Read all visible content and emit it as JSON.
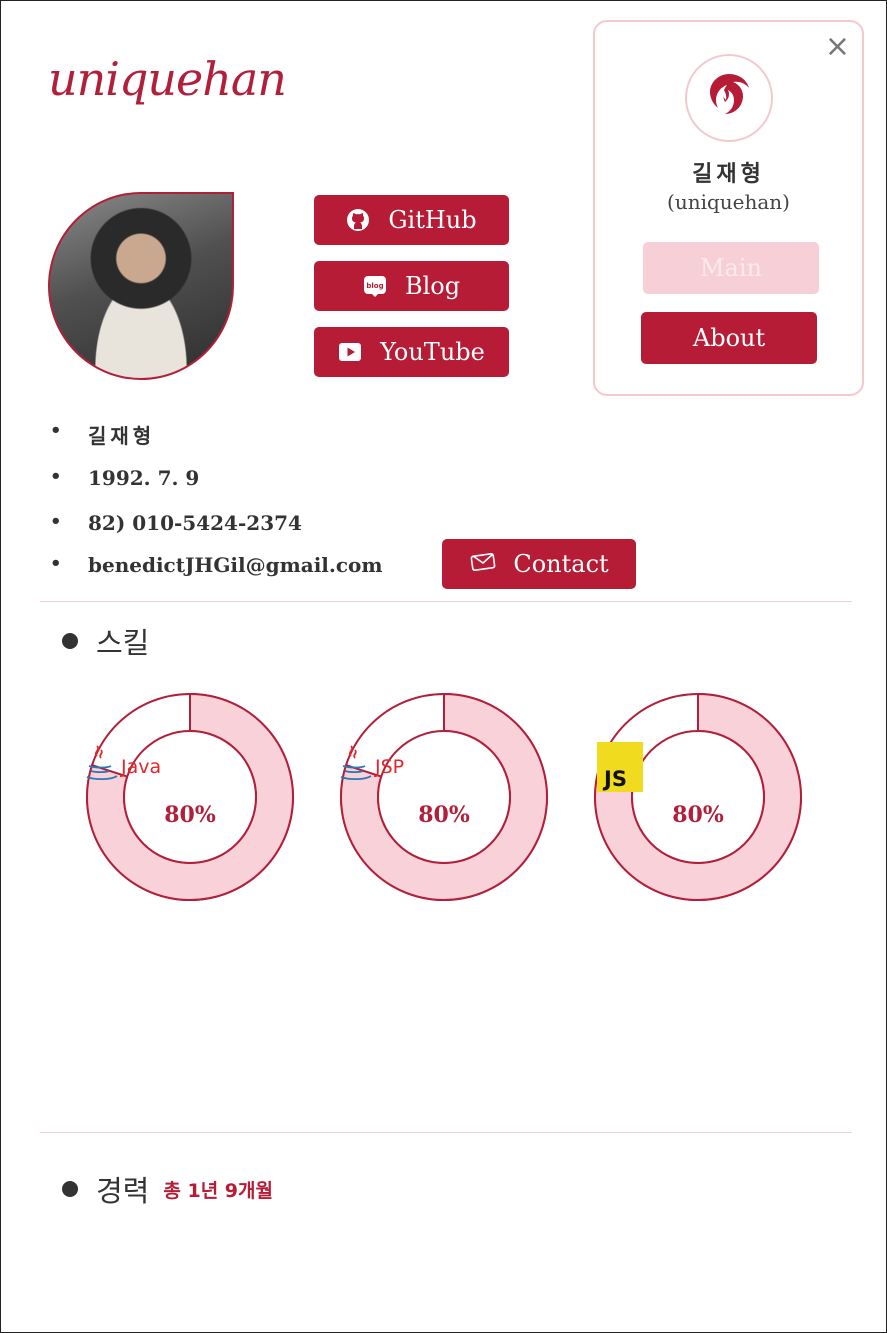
{
  "brand": {
    "logo_text": "uniquehan"
  },
  "social": {
    "github_label": "GitHub",
    "blog_label": "Blog",
    "youtube_label": "YouTube",
    "blog_icon_text": "blog"
  },
  "profile_card": {
    "name": "길재형",
    "handle": "(uniquehan)",
    "main_label": "Main",
    "about_label": "About"
  },
  "info": {
    "name": "길재형",
    "birth": "1992. 7. 9",
    "phone": "82) 010-5424-2374",
    "email": "benedictJHGil@gmail.com",
    "contact_label": "Contact"
  },
  "skills": {
    "heading": "스킬",
    "items": [
      {
        "name": "Java",
        "percent": "80%",
        "value": 0.8
      },
      {
        "name": "JSP",
        "percent": "80%",
        "value": 0.8
      },
      {
        "name": "JS",
        "percent": "80%",
        "value": 0.8
      }
    ]
  },
  "career": {
    "heading": "경력",
    "total": "총 1년 9개월"
  },
  "colors": {
    "accent": "#b71c36",
    "ring_fill": "#f8d2d8",
    "ring_stroke": "#b21f3a"
  }
}
